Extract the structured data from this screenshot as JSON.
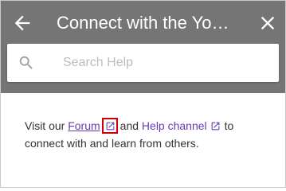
{
  "header": {
    "title": "Connect with the YouTube community",
    "back_icon": "arrow-left-icon",
    "close_icon": "close-icon",
    "background_color": "#757575"
  },
  "search": {
    "placeholder": "Search Help",
    "value": "",
    "icon": "search-icon"
  },
  "content": {
    "text_before": "Visit our",
    "forum_link": "Forum",
    "text_middle": "and",
    "channel_link": "Help channel",
    "text_after_line1": "to",
    "text_line2": "connect with and learn from others.",
    "link_color": "#673ab7",
    "highlight_color": "#d00000",
    "external_icon": "open-in-new-icon"
  }
}
